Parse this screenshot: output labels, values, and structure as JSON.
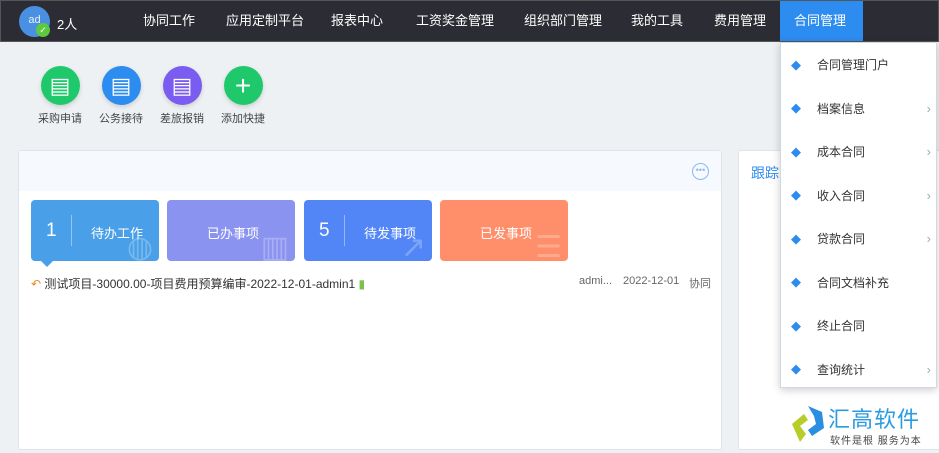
{
  "header": {
    "avatar_text": "ad",
    "people": "2人",
    "nav": [
      "协同工作",
      "应用定制平台",
      "报表中心",
      "工资奖金管理",
      "组织部门管理",
      "我的工具",
      "费用管理",
      "合同管理"
    ],
    "active": "合同管理"
  },
  "quick": [
    {
      "label": "采购申请",
      "color": "#1fc96b",
      "icon": "document-user-icon"
    },
    {
      "label": "公务接待",
      "color": "#2d8cf0",
      "icon": "document-user-icon"
    },
    {
      "label": "差旅报销",
      "color": "#7a5cf0",
      "icon": "document-user-icon"
    },
    {
      "label": "添加快捷",
      "color": "#1fc96b",
      "icon": "plus-icon"
    }
  ],
  "tiles": [
    {
      "num": "1",
      "label": "待办工作",
      "color": "#4aa0e8"
    },
    {
      "num": "",
      "label": "已办事项",
      "color": "#8a93f0"
    },
    {
      "num": "5",
      "label": "待发事项",
      "color": "#5286f7"
    },
    {
      "num": "",
      "label": "已发事项",
      "color": "#ff8f6b"
    }
  ],
  "row": {
    "title": "测试项目-30000.00-项目费用预算编审-2022-12-01-admin1",
    "author": "admi...",
    "date": "2022-12-01",
    "type": "协同"
  },
  "right_panel": {
    "title": "跟踪"
  },
  "dropdown": [
    {
      "label": "合同管理门户",
      "sub": false
    },
    {
      "label": "档案信息",
      "sub": true
    },
    {
      "label": "成本合同",
      "sub": true
    },
    {
      "label": "收入合同",
      "sub": true
    },
    {
      "label": "贷款合同",
      "sub": true
    },
    {
      "label": "合同文档补充",
      "sub": false
    },
    {
      "label": "终止合同",
      "sub": false
    },
    {
      "label": "查询统计",
      "sub": true
    }
  ],
  "logo": {
    "name": "汇高软件",
    "slogan": "软件是根 服务为本"
  }
}
